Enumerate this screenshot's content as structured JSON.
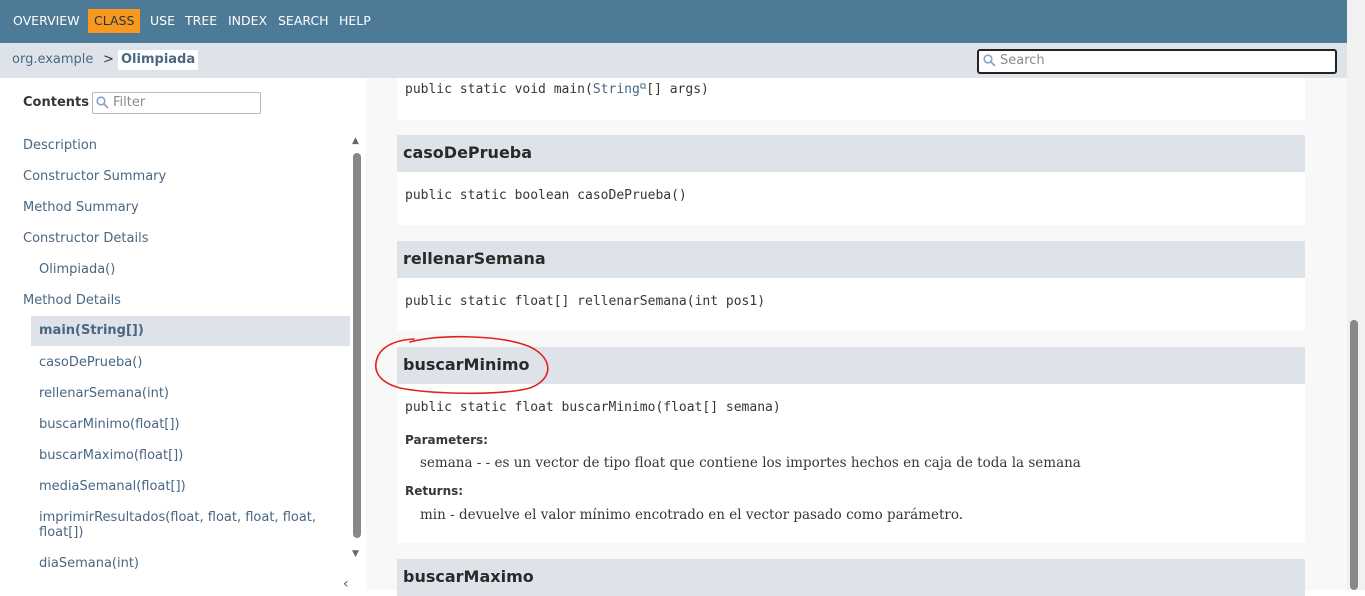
{
  "topnav": {
    "items": [
      "OVERVIEW",
      "CLASS",
      "USE",
      "TREE",
      "INDEX",
      "SEARCH",
      "HELP"
    ],
    "active": "CLASS"
  },
  "breadcrumb": {
    "package": "org.example",
    "separator": ">",
    "class": "Olimpiada"
  },
  "search": {
    "placeholder": "Search"
  },
  "toc": {
    "title": "Contents",
    "filter_placeholder": "Filter",
    "items": [
      {
        "label": "Description"
      },
      {
        "label": "Constructor Summary"
      },
      {
        "label": "Method Summary"
      },
      {
        "label": "Constructor Details"
      },
      {
        "label": "Olimpiada()"
      },
      {
        "label": "Method Details"
      },
      {
        "label": "main(String[])"
      },
      {
        "label": "casoDePrueba()"
      },
      {
        "label": "rellenarSemana(int)"
      },
      {
        "label": "buscarMinimo(float[])"
      },
      {
        "label": "buscarMaximo(float[])"
      },
      {
        "label": "mediaSemanal(float[])"
      },
      {
        "label": "imprimirResultados(float, float, float, float,"
      },
      {
        "label": "float[])"
      },
      {
        "label": "diaSemana(int)"
      }
    ],
    "active": "main(String[])",
    "collapse_glyph": "‹"
  },
  "methods": {
    "main": {
      "sig_pre": "public static void main(",
      "sig_link": "String",
      "sig_post": "[] args)"
    },
    "casoDePrueba": {
      "name": "casoDePrueba",
      "sig": "public static boolean casoDePrueba()"
    },
    "rellenarSemana": {
      "name": "rellenarSemana",
      "sig": "public static float[] rellenarSemana(int pos1)"
    },
    "buscarMinimo": {
      "name": "buscarMinimo",
      "sig": "public static float buscarMinimo(float[] semana)",
      "params_label": "Parameters:",
      "param_desc": "semana - - es un vector de tipo float que contiene los importes hechos en caja de toda la semana",
      "returns_label": "Returns:",
      "returns_desc": "min - devuelve el valor mínimo encotrado en el vector pasado como parámetro."
    },
    "buscarMaximo": {
      "name": "buscarMaximo"
    }
  },
  "colors": {
    "nav": "#4d7a97",
    "active": "#f8981d",
    "subnav": "#dee3e9",
    "annotation": "#e0221e"
  }
}
